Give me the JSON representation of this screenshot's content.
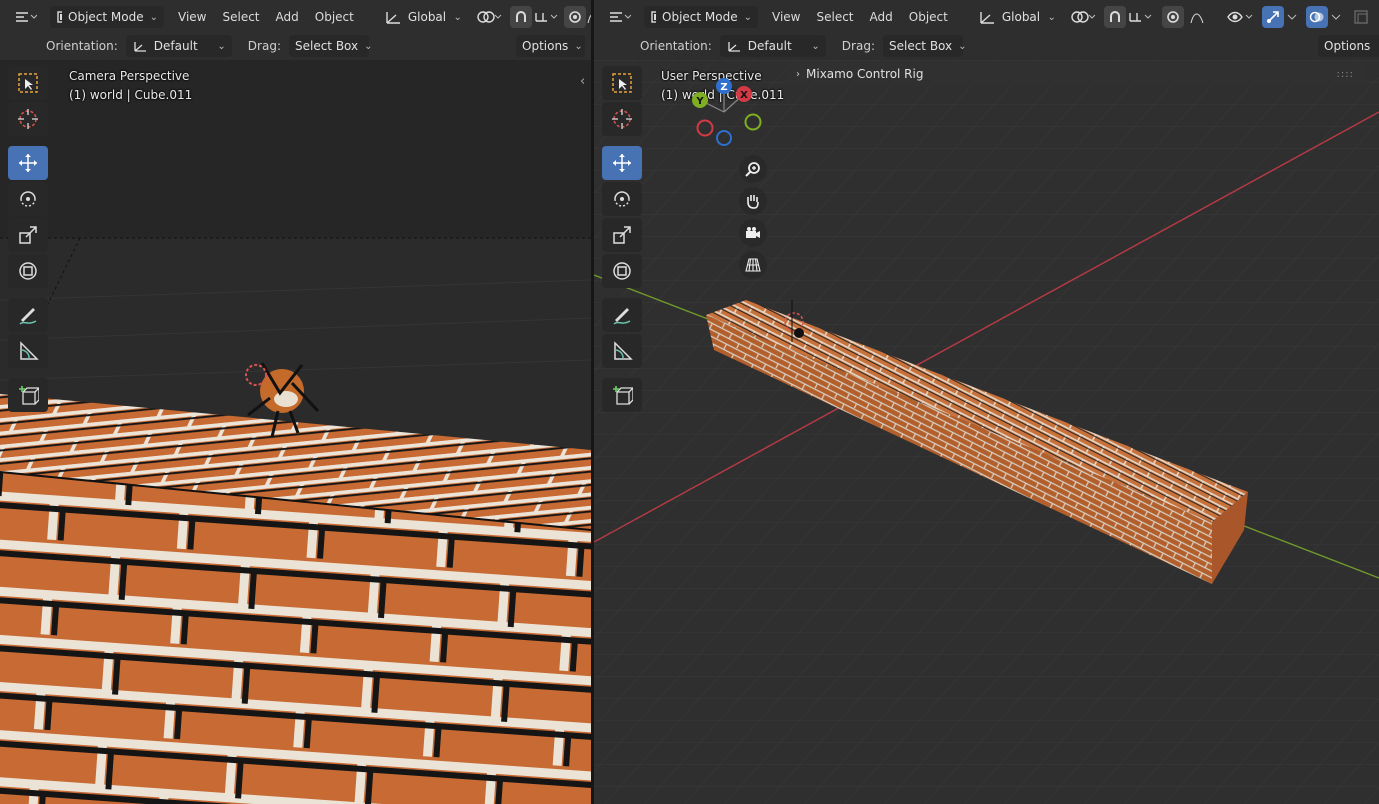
{
  "left_viewport": {
    "header": {
      "mode": "Object Mode",
      "menu": [
        "View",
        "Select",
        "Add",
        "Object"
      ],
      "transform_space": "Global",
      "orientation_label": "Orientation:",
      "orientation_value": "Default",
      "drag_label": "Drag:",
      "drag_value": "Select Box",
      "options_label": "Options"
    },
    "overlay": {
      "view_name": "Camera Perspective",
      "context": "(1) world | Cube.011"
    }
  },
  "right_viewport": {
    "header": {
      "mode": "Object Mode",
      "menu": [
        "View",
        "Select",
        "Add",
        "Object"
      ],
      "transform_space": "Global",
      "orientation_label": "Orientation:",
      "orientation_value": "Default",
      "drag_label": "Drag:",
      "drag_value": "Select Box",
      "options_label": "Options"
    },
    "overlay": {
      "view_name": "User Perspective",
      "context": "(1) world | Cube.011"
    },
    "gizmo": {
      "z": "Z",
      "x": "X",
      "y": "Y"
    },
    "sidebar_panel": {
      "title": "Mixamo Control Rig"
    }
  },
  "toolbar_tools": [
    "select-box",
    "cursor",
    "move",
    "rotate",
    "scale",
    "transform",
    "annotate",
    "measure",
    "add-cube"
  ],
  "active_tool": "move",
  "colors": {
    "accent": "#4772b3",
    "brick": "#c76a33",
    "mortar": "#e9e1d6",
    "grid": "#3a3a3a",
    "x_axis": "#b93a44",
    "y_axis": "#6f9a2b"
  }
}
